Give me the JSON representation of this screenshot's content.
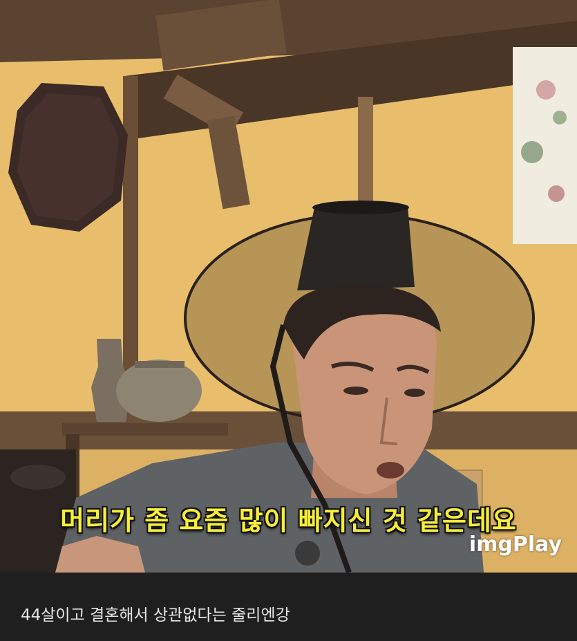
{
  "video": {
    "subtitle": "머리가 좀 요즘 많이 빠지신 것 같은데요",
    "watermark": "imgPlay",
    "subtitle_color": "#f7ee3a"
  },
  "post": {
    "caption": "44살이고 결혼해서 상관없다는 줄리엔강"
  }
}
